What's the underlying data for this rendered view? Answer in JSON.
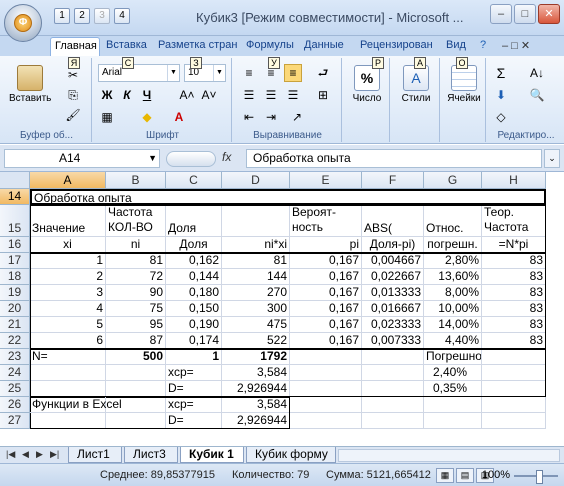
{
  "window": {
    "title": "Кубик3  [Режим совместимости] - Microsoft ...",
    "orb_key": "Ф",
    "qat_keys": [
      "1",
      "2",
      "3",
      "4"
    ],
    "buttons": [
      "–",
      "□",
      "✕"
    ]
  },
  "ribbon_tabs": [
    "Главная",
    "Вставка",
    "Разметка стран",
    "Формулы",
    "Данные",
    "Рецензирован",
    "Вид"
  ],
  "ribbon": {
    "clipboard": {
      "paste_label": "Вставить",
      "group_label": "Буфер об...",
      "key": "Я"
    },
    "font": {
      "font_name": "Arial",
      "font_size": "10",
      "group_label": "Шрифт",
      "bold": "Ж",
      "italic": "К",
      "underline": "Ч",
      "key_name": "С",
      "key_size": "З"
    },
    "alignment": {
      "group_label": "Выравнивание",
      "key": "У"
    },
    "number": {
      "label": "Число",
      "symbol": "%",
      "key": "Р"
    },
    "styles": {
      "label": "Стили",
      "key": "А"
    },
    "cells": {
      "label": "Ячейки",
      "key": "О"
    },
    "editing": {
      "group_label": "Редактиро..."
    }
  },
  "formula_bar": {
    "name_box": "A14",
    "fx": "fx",
    "content": "Обработка  опыта"
  },
  "columns": [
    "A",
    "B",
    "C",
    "D",
    "E",
    "F",
    "G",
    "H"
  ],
  "rows": [
    "14",
    "15",
    "16",
    "17",
    "18",
    "19",
    "20",
    "21",
    "22",
    "23",
    "24",
    "25",
    "26",
    "27"
  ],
  "cells": {
    "r14": {
      "a": "Обработка  опыта"
    },
    "r15": {
      "a": "Значение",
      "b1": "Частота",
      "b2": "КОЛ-ВО",
      "c": "Доля",
      "e1": "Вероят-",
      "e2": "ность",
      "f": "ABS(",
      "g": "Относ.",
      "h1": "Теор.",
      "h2": "Частота"
    },
    "r16": {
      "a": "xi",
      "b": "ni",
      "c": "Доля",
      "d": "ni*xi",
      "e": "pi",
      "f": "Доля-pi)",
      "g": "погрешн.",
      "h": "=N*pi"
    },
    "data": [
      [
        "1",
        "81",
        "0,162",
        "81",
        "0,167",
        "0,004667",
        "2,80%",
        "83"
      ],
      [
        "2",
        "72",
        "0,144",
        "144",
        "0,167",
        "0,022667",
        "13,60%",
        "83"
      ],
      [
        "3",
        "90",
        "0,180",
        "270",
        "0,167",
        "0,013333",
        "8,00%",
        "83"
      ],
      [
        "4",
        "75",
        "0,150",
        "300",
        "0,167",
        "0,016667",
        "10,00%",
        "83"
      ],
      [
        "5",
        "95",
        "0,190",
        "475",
        "0,167",
        "0,023333",
        "14,00%",
        "83"
      ],
      [
        "6",
        "87",
        "0,174",
        "522",
        "0,167",
        "0,007333",
        "4,40%",
        "83"
      ]
    ],
    "r23": {
      "a": "N=",
      "b": "500",
      "c": "1",
      "d": "1792",
      "g": "Погрешность"
    },
    "r24": {
      "c": "xcp=",
      "d": "3,584",
      "g": "2,40%"
    },
    "r25": {
      "c": "D=",
      "d": "2,926944",
      "g": "0,35%"
    },
    "r26": {
      "a": "Функции в Excel",
      "c": "xcp=",
      "d": "3,584"
    },
    "r27": {
      "c": "D=",
      "d": "2,926944"
    }
  },
  "sheets": [
    "Лист1",
    "Лист3",
    "Кубик 1",
    "Кубик форму"
  ],
  "status": {
    "average": "Среднее: 89,85377915",
    "count": "Количество: 79",
    "sum": "Сумма: 5121,665412",
    "zoom": "100%"
  }
}
